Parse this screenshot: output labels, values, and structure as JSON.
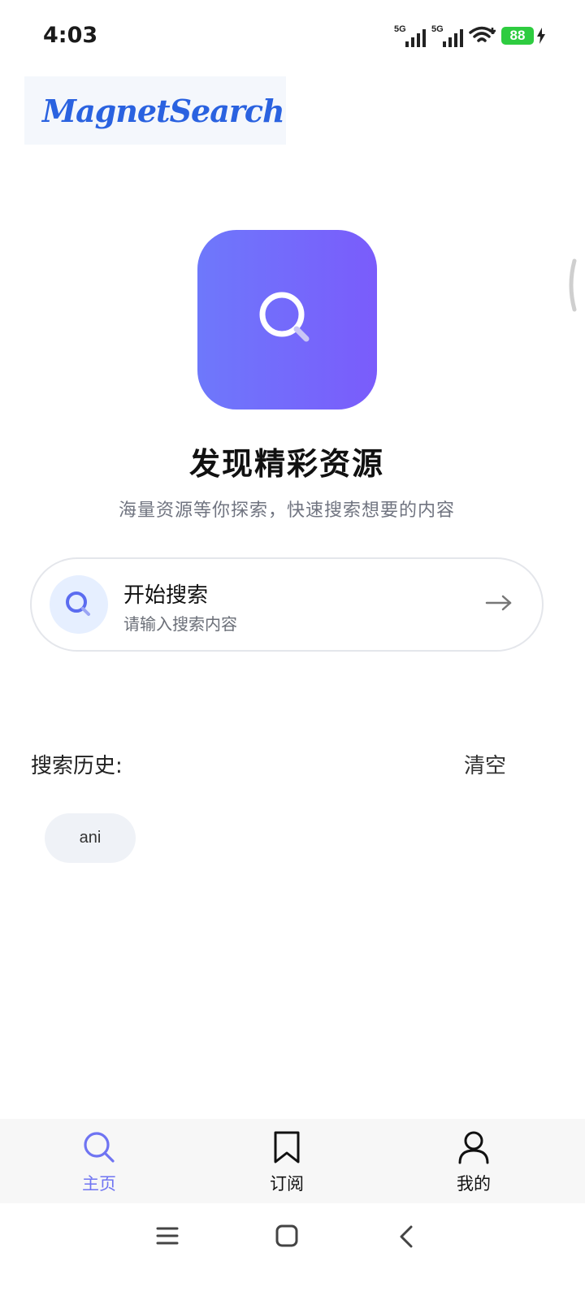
{
  "status_bar": {
    "time": "4:03",
    "sim1_label": "5G",
    "sim2_label": "5G",
    "battery_level": "88"
  },
  "app": {
    "logo_text": "MagnetSearch"
  },
  "hero": {
    "title": "发现精彩资源",
    "subtitle": "海量资源等你探索，快速搜索想要的内容"
  },
  "search_card": {
    "title": "开始搜索",
    "hint": "请输入搜索内容"
  },
  "history": {
    "label": "搜索历史:",
    "clear_label": "清空",
    "items": [
      "ani"
    ]
  },
  "bottom_nav": {
    "items": [
      {
        "label": "主页",
        "icon": "search-icon",
        "active": true
      },
      {
        "label": "订阅",
        "icon": "bookmark-icon",
        "active": false
      },
      {
        "label": "我的",
        "icon": "person-icon",
        "active": false
      }
    ]
  },
  "colors": {
    "accent": "#6f74f2",
    "gradient_start": "#6e78fb",
    "gradient_end": "#7a5cfb",
    "battery": "#2ecc40"
  },
  "icons": {
    "system_nav": [
      "menu-icon",
      "home-icon",
      "back-icon"
    ]
  }
}
